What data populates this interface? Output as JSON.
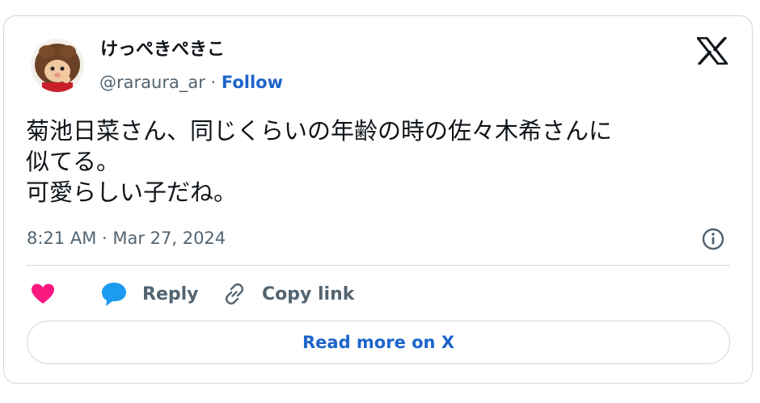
{
  "tweet": {
    "author_name": "けっぺきぺきこ",
    "handle": "@raraura_ar",
    "separator": " · ",
    "follow_label": "Follow",
    "text_lines": [
      "菊池日菜さん、同じくらいの年齢の時の佐々木希さんに",
      "似てる。",
      "可愛らしい子だね。"
    ],
    "timestamp": "8:21 AM · Mar 27, 2024"
  },
  "actions": {
    "reply_label": "Reply",
    "copy_link_label": "Copy link"
  },
  "read_more_label": "Read more on X",
  "colors": {
    "text": "#0f1419",
    "secondary": "#536471",
    "link": "#1d65c9",
    "heart": "#f91880",
    "reply_bubble": "#1d9bf0",
    "border": "#cfd9de"
  },
  "icons": [
    "x-logo-icon",
    "info-icon",
    "heart-icon",
    "reply-icon",
    "link-icon"
  ]
}
